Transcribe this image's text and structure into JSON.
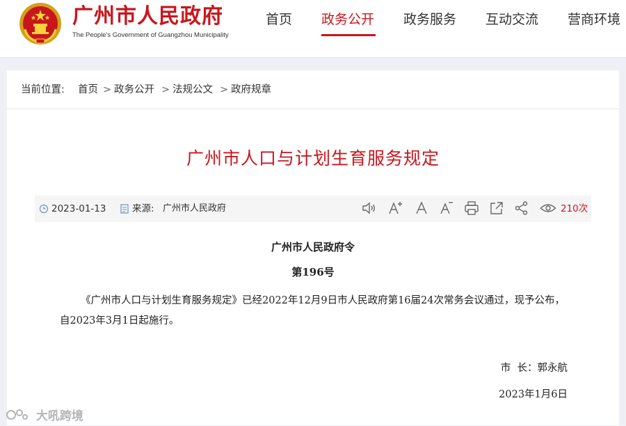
{
  "header": {
    "site_name": "广州市人民政府",
    "site_name_en": "The People's Government of Guangzhou Municipality",
    "nav": [
      {
        "label": "首页",
        "active": false
      },
      {
        "label": "政务公开",
        "active": true
      },
      {
        "label": "政务服务",
        "active": false
      },
      {
        "label": "互动交流",
        "active": false
      },
      {
        "label": "营商环境",
        "active": false
      }
    ],
    "accent_color": "#c8161d"
  },
  "breadcrumb": {
    "prefix": "当前位置:",
    "items": [
      "首页",
      "政务公开",
      "法规公文",
      "政府规章"
    ],
    "separator": ">"
  },
  "article": {
    "title": "广州市人口与计划生育服务规定",
    "date": "2023-01-13",
    "source_label": "来源:",
    "source": "广州市人民政府",
    "views": "210次",
    "tools": [
      "speaker-icon",
      "font-increase-icon",
      "font-reset-icon",
      "font-decrease-icon",
      "print-icon",
      "share-out-icon",
      "share-icon",
      "eye-icon"
    ]
  },
  "document": {
    "heading": "广州市人民政府令",
    "number": "第196号",
    "body": "《广州市人口与计划生育服务规定》已经2022年12月9日市人民政府第16届24次常务会议通过，现予公布，自2023年3月1日起施行。",
    "signer": "市  长：郭永航",
    "date": "2023年1月6日"
  },
  "watermark": {
    "text": "大吼跨境"
  }
}
